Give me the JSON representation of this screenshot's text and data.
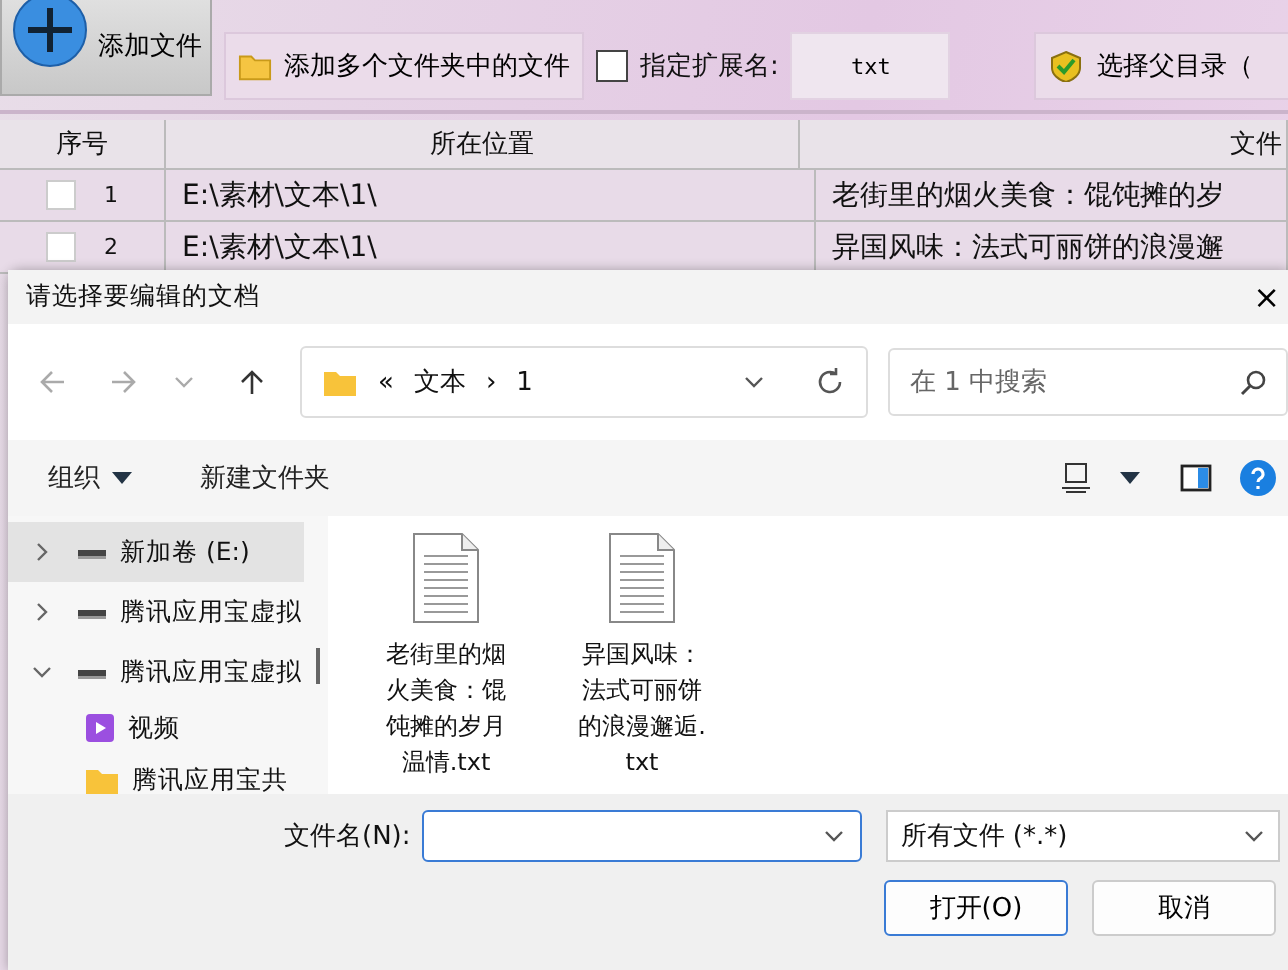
{
  "toolbar": {
    "add_file": "添加文件",
    "add_folders": "添加多个文件夹中的文件",
    "ext_filter": {
      "checked": false,
      "label": "指定扩展名:",
      "value": "txt"
    },
    "choose_parent": "选择父目录（"
  },
  "table": {
    "columns": [
      "序号",
      "所在位置",
      "文件"
    ],
    "rows": [
      {
        "checked": false,
        "index": "1",
        "location": "E:\\素材\\文本\\1\\",
        "file": "老街里的烟火美食：馄饨摊的岁"
      },
      {
        "checked": false,
        "index": "2",
        "location": "E:\\素材\\文本\\1\\",
        "file": "异国风味：法式可丽饼的浪漫邂"
      }
    ]
  },
  "dialog": {
    "title": "请选择要编辑的文档",
    "close": "×",
    "address": {
      "overflow": "«",
      "crumbs": [
        "文本",
        "1"
      ],
      "separator": "›"
    },
    "search": {
      "placeholder": "在 1 中搜索"
    },
    "commands": {
      "organize": "组织",
      "new_folder": "新建文件夹"
    },
    "sidebar": {
      "items": [
        {
          "kind": "drive",
          "label": "新加卷 (E:)",
          "selected": true,
          "expanded": false
        },
        {
          "kind": "drive",
          "label": "腾讯应用宝虚拟",
          "selected": false,
          "expanded": false
        },
        {
          "kind": "drive",
          "label": "腾讯应用宝虚拟",
          "selected": false,
          "expanded": true,
          "children": [
            {
              "kind": "video",
              "label": "视频",
              "selected": false
            },
            {
              "kind": "folder",
              "label": "腾讯应用宝共",
              "selected": false
            }
          ]
        }
      ]
    },
    "files": [
      {
        "name": "老街里的烟火美食：馄饨摊的岁月温情.txt"
      },
      {
        "name": "异国风味：法式可丽饼的浪漫邂逅.txt"
      }
    ],
    "filename": {
      "label": "文件名(N):"
    },
    "filter": "所有文件 (*.*)",
    "buttons": [
      {
        "label": "打开(O)",
        "kind": "primary"
      },
      {
        "label": "取消",
        "kind": "secondary"
      }
    ]
  }
}
